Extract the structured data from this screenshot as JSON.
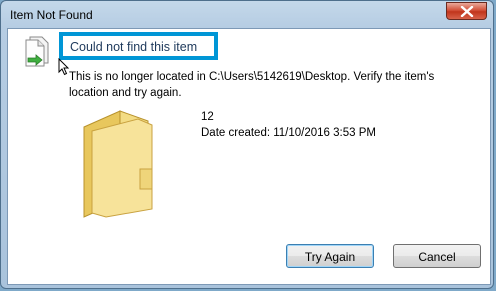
{
  "window": {
    "title": "Item Not Found"
  },
  "dialog": {
    "heading": "Could not find this item",
    "message": "This is no longer located in C:\\Users\\5142619\\Desktop. Verify the item's location and try again.",
    "item": {
      "name": "12",
      "date_created": "Date created: 11/10/2016 3:53 PM"
    }
  },
  "buttons": {
    "try_again": "Try Again",
    "cancel": "Cancel"
  },
  "icons": {
    "close": "close-icon",
    "document": "document-arrow-icon",
    "folder": "folder-icon",
    "cursor": "mouse-pointer-icon"
  },
  "colors": {
    "highlight": "#0096d6",
    "heading": "#1e395b",
    "close_button": "#c1351c"
  }
}
